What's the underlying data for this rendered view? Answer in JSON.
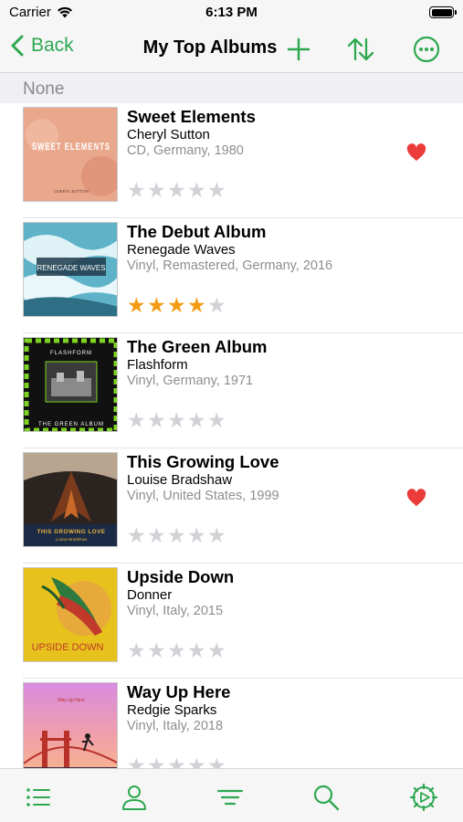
{
  "status": {
    "carrier": "Carrier",
    "time": "6:13 PM"
  },
  "nav": {
    "back_label": "Back",
    "title": "My Top Albums"
  },
  "section": {
    "title": "None"
  },
  "colors": {
    "accent": "#2ea84f",
    "star": "#f39c12",
    "heart": "#ec3b3b"
  },
  "albums": [
    {
      "title": "Sweet Elements",
      "artist": "Cheryl Sutton",
      "details": "CD, Germany, 1980",
      "rating": 0,
      "favorite": true,
      "cover_text": "SWEET ELEMENTS",
      "cover_small": "CHERYL SUTTON"
    },
    {
      "title": "The Debut Album",
      "artist": "Renegade Waves",
      "details": "Vinyl, Remastered, Germany, 2016",
      "rating": 4,
      "favorite": false,
      "cover_text": "RENEGADE WAVES"
    },
    {
      "title": "The Green Album",
      "artist": "Flashform",
      "details": "Vinyl, Germany, 1971",
      "rating": 0,
      "favorite": false,
      "cover_text": "FLASHFORM",
      "cover_small": "THE GREEN ALBUM"
    },
    {
      "title": "This Growing Love",
      "artist": "Louise Bradshaw",
      "details": "Vinyl, United States, 1999",
      "rating": 0,
      "favorite": true,
      "cover_text": "THIS GROWING LOVE",
      "cover_small": "Louise Bradshaw"
    },
    {
      "title": "Upside Down",
      "artist": "Donner",
      "details": "Vinyl, Italy, 2015",
      "rating": 0,
      "favorite": false,
      "cover_text": "UPSIDE DOWN"
    },
    {
      "title": "Way Up Here",
      "artist": "Redgie Sparks",
      "details": "Vinyl, Italy, 2018",
      "rating": 0,
      "favorite": false,
      "cover_text": "Way Up Here"
    }
  ],
  "tabs": [
    "list-icon",
    "person-icon",
    "filter-icon",
    "search-icon",
    "settings-icon"
  ]
}
